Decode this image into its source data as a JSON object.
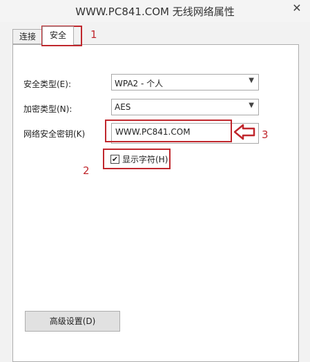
{
  "window": {
    "title": "WWW.PC841.COM 无线网络属性",
    "close_glyph": "✕"
  },
  "tabs": [
    {
      "label": "连接"
    },
    {
      "label": "安全"
    }
  ],
  "fields": {
    "security_type": {
      "label": "安全类型(E):",
      "value": "WPA2 - 个人"
    },
    "encryption_type": {
      "label": "加密类型(N):",
      "value": "AES"
    },
    "network_key": {
      "label": "网络安全密钥(K)",
      "value": "WWW.PC841.COM"
    }
  },
  "show_chars": {
    "label": "显示字符(H)",
    "checked": true
  },
  "advanced_button": {
    "label": "高级设置(D)"
  },
  "annotations": {
    "one": "1",
    "two": "2",
    "three": "3",
    "color": "#c0272d"
  }
}
